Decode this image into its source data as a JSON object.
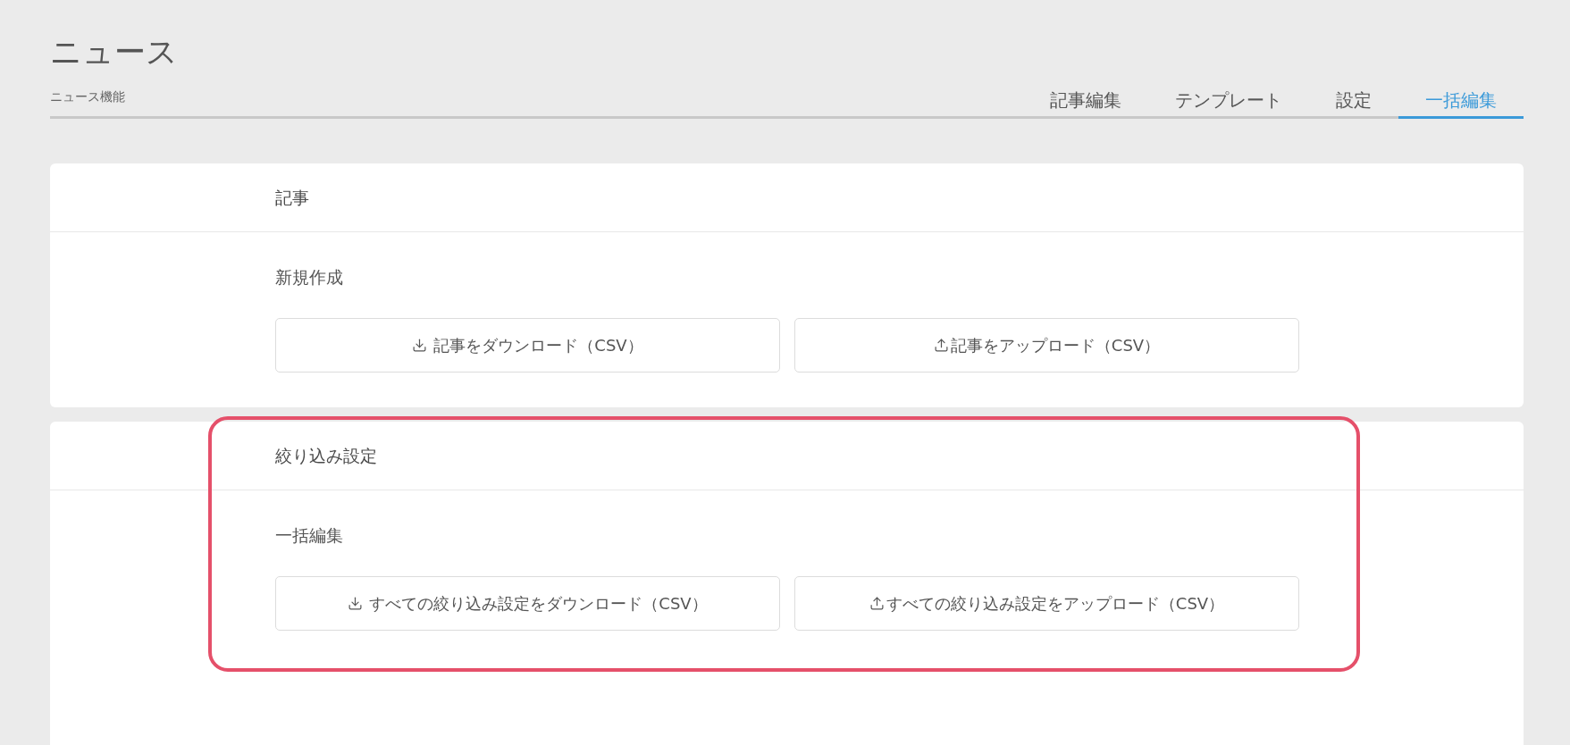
{
  "page": {
    "title": "ニュース",
    "subtitle": "ニュース機能"
  },
  "tabs": [
    {
      "label": "記事編集",
      "selected": false
    },
    {
      "label": "テンプレート",
      "selected": false
    },
    {
      "label": "設定",
      "selected": false
    },
    {
      "label": "一括編集",
      "selected": true
    }
  ],
  "sections": [
    {
      "title": "記事",
      "highlighted": false,
      "group_label": "新規作成",
      "buttons": [
        {
          "kind": "download",
          "label": "記事をダウンロード（CSV）"
        },
        {
          "kind": "upload",
          "label": "記事をアップロード（CSV）"
        }
      ]
    },
    {
      "title": "絞り込み設定",
      "highlighted": true,
      "group_label": "一括編集",
      "buttons": [
        {
          "kind": "download",
          "label": "すべての絞り込み設定をダウンロード（CSV）"
        },
        {
          "kind": "upload",
          "label": "すべての絞り込み設定をアップロード（CSV）"
        }
      ]
    }
  ]
}
